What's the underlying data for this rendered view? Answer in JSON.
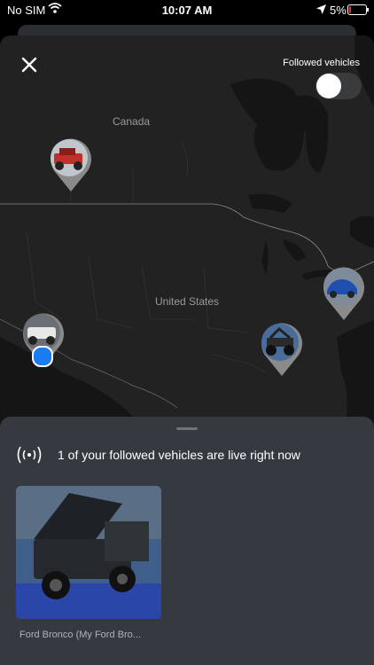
{
  "status_bar": {
    "carrier": "No SIM",
    "time": "10:07 AM",
    "battery": "5%"
  },
  "map": {
    "labels": {
      "canada": "Canada",
      "united_states": "United States"
    }
  },
  "header": {
    "close_icon": "close-icon",
    "toggle_label": "Followed vehicles",
    "toggle_on": false
  },
  "panel": {
    "live_icon": "broadcast-icon",
    "live_text": "1 of your followed vehicles are live right now",
    "vehicles": [
      {
        "title": "Ford Bronco (My Ford Bro..."
      }
    ]
  },
  "colors": {
    "panel": "#353a40",
    "map": "#222222",
    "location": "#1b7cf0"
  }
}
